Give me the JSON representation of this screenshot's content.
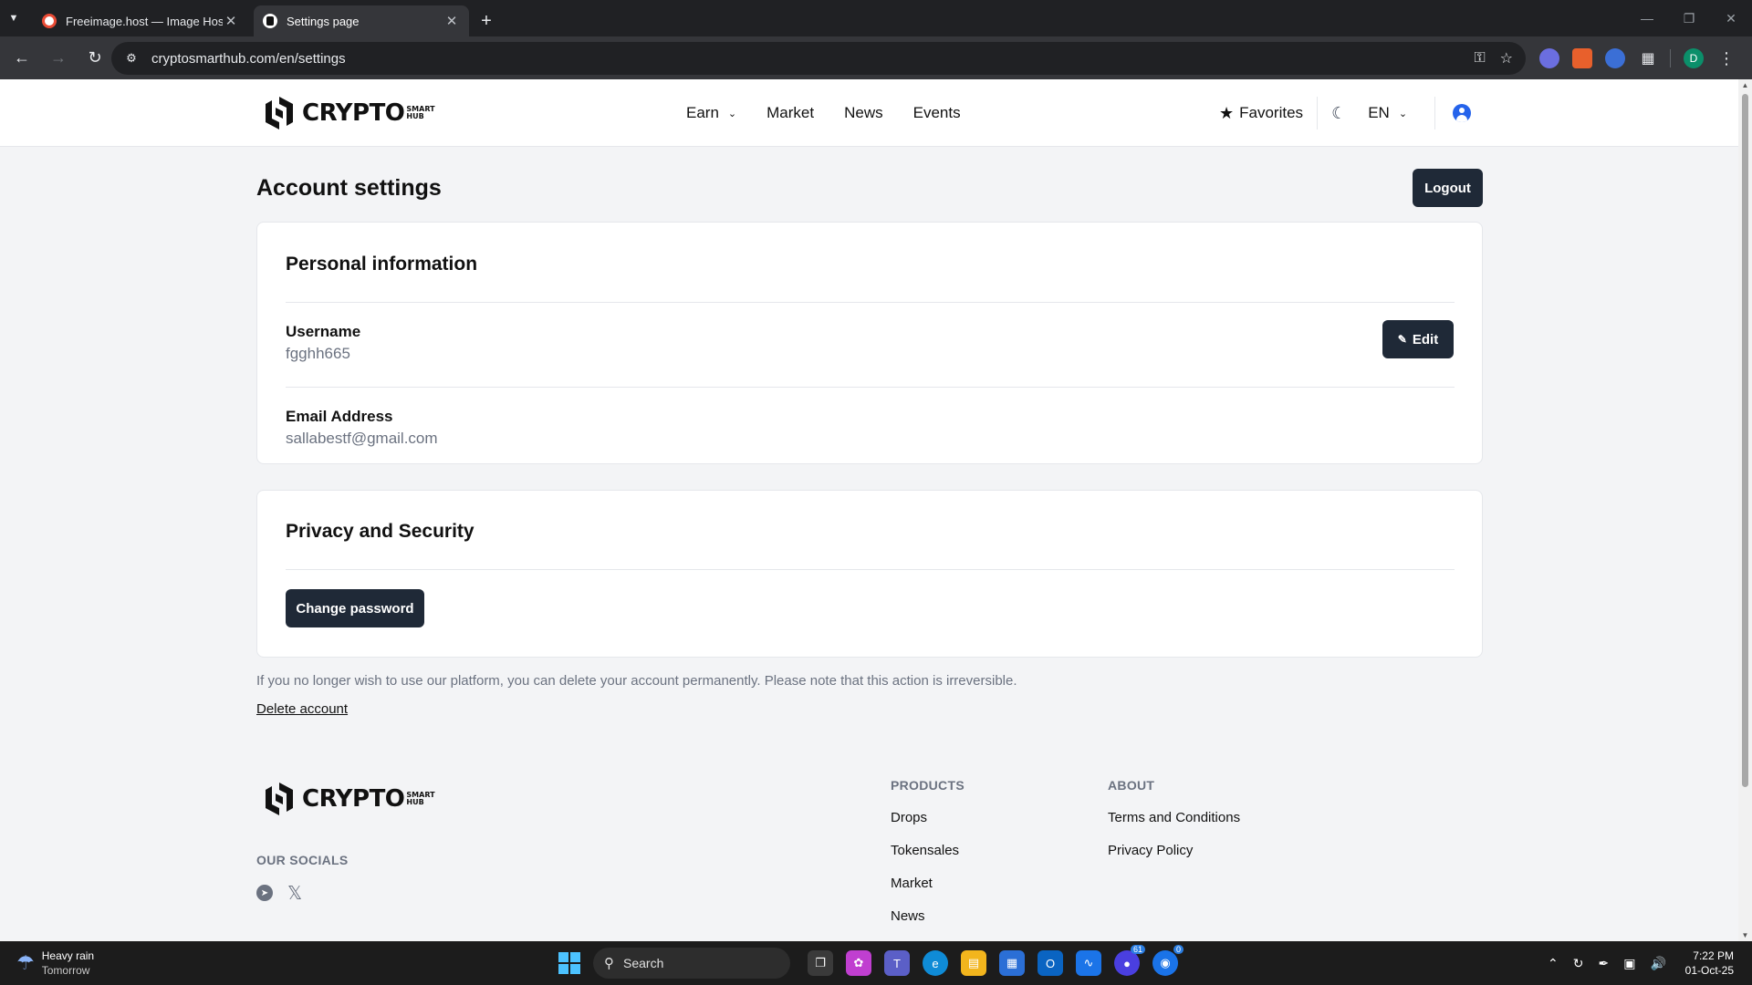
{
  "browser": {
    "tabs": [
      {
        "title": "Freeimage.host — Image Hosting",
        "active": false
      },
      {
        "title": "Settings page",
        "active": true
      }
    ],
    "url": "cryptosmarthub.com/en/settings",
    "profile_initial": "D"
  },
  "brand": {
    "word": "CRYPTO",
    "sub_top": "SMART",
    "sub_bottom": "HUB"
  },
  "nav": {
    "items": [
      "Earn",
      "Market",
      "News",
      "Events"
    ],
    "favorites": "Favorites",
    "language": "EN"
  },
  "page": {
    "title": "Account settings",
    "logout": "Logout",
    "personal": {
      "heading": "Personal information",
      "username_label": "Username",
      "username_value": "fgghh665",
      "edit": "Edit",
      "email_label": "Email Address",
      "email_value": "sallabestf@gmail.com"
    },
    "privacy": {
      "heading": "Privacy and Security",
      "change_password": "Change password"
    },
    "delete_note": "If you no longer wish to use our platform, you can delete your account permanently. Please note that this action is irreversible.",
    "delete_link": "Delete account"
  },
  "footer": {
    "socials_title": "OUR SOCIALS",
    "products_title": "PRODUCTS",
    "products": [
      "Drops",
      "Tokensales",
      "Market",
      "News"
    ],
    "about_title": "ABOUT",
    "about": [
      "Terms and Conditions",
      "Privacy Policy"
    ]
  },
  "taskbar": {
    "weather_title": "Heavy rain",
    "weather_sub": "Tomorrow",
    "search": "Search",
    "badge_1": "61",
    "badge_2": "0",
    "time": "7:22 PM",
    "date": "01-Oct-25"
  },
  "colors": {
    "primary_button": "#1f2937",
    "accent_user": "#2563eb",
    "page_bg": "#f3f4f6"
  }
}
